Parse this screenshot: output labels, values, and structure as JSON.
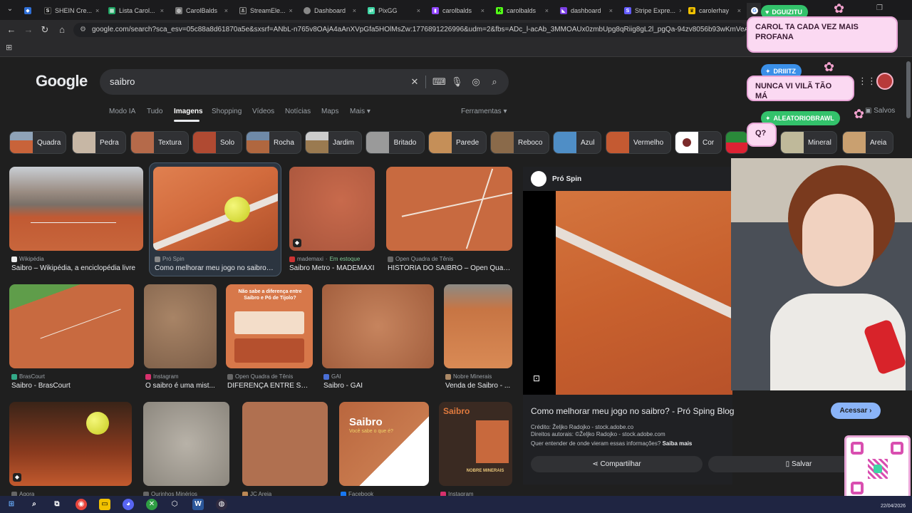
{
  "browser": {
    "tabs": [
      {
        "label": "",
        "icon": "diamond-icon",
        "color": "#2f6fd6"
      },
      {
        "label": "SHEIN Cre...",
        "icon": "shein-icon",
        "color": "#111111"
      },
      {
        "label": "Lista Carol...",
        "icon": "sheets-icon",
        "color": "#1ea362"
      },
      {
        "label": "CarolBalds",
        "icon": "globe-icon",
        "color": "#777777"
      },
      {
        "label": "StreamEle...",
        "icon": "streamelements-icon",
        "color": "#222222"
      },
      {
        "label": "Dashboard",
        "icon": "globe-icon",
        "color": "#888888"
      },
      {
        "label": "PixGG",
        "icon": "pixgg-icon",
        "color": "#3fd6a5"
      },
      {
        "label": "carolbalds",
        "icon": "twitch-icon",
        "color": "#9146ff"
      },
      {
        "label": "carolbalds",
        "icon": "kick-icon",
        "color": "#53fc18"
      },
      {
        "label": "dashboard",
        "icon": "dashboard-icon",
        "color": "#7b3fe4"
      },
      {
        "label": "Stripe Expre...",
        "icon": "stripe-icon",
        "color": "#635bff"
      },
      {
        "label": "carolerhay",
        "icon": "crown-icon",
        "color": "#f2c200"
      },
      {
        "label": "",
        "icon": "google-icon",
        "color": "#ffffff"
      }
    ],
    "url": "google.com/search?sca_esv=05c88a8d61870a5e&sxsrf=ANbL-n765v8OAjA4aAnXVpGfa5HOlMsZw:1776891226996&udm=2&fbs=ADc_l-acAb_3MMOAUx0zmbUpg8qRiig8gL2l_pgQa-94zv8056b93wKmVeAAORa3GINFZT6T67F"
  },
  "google": {
    "logo": "Google",
    "query": "saibro",
    "nav_tabs": [
      "Modo IA",
      "Tudo",
      "Imagens",
      "Shopping",
      "Vídeos",
      "Notícias",
      "Maps",
      "Mais"
    ],
    "active_tab": "Imagens",
    "tools": "Ferramentas",
    "saved": "Salvos",
    "chips": [
      "Quadra",
      "Pedra",
      "Textura",
      "Solo",
      "Rocha",
      "Jardim",
      "Britado",
      "Parede",
      "Reboco",
      "Azul",
      "Vermelho",
      "Cor",
      "",
      "Mineral",
      "Areia"
    ],
    "results": [
      {
        "source": "Wikipédia",
        "title": "Saibro – Wikipédia, a enciclopédia livre",
        "stock": ""
      },
      {
        "source": "Pró Spin",
        "title": "Como melhorar meu jogo no saibro? ...",
        "stock": ""
      },
      {
        "source": "mademaxi",
        "title": "Saibro Metro - MADEMAXI",
        "stock": "Em estoque"
      },
      {
        "source": "Open Quadra de Tênis",
        "title": "HISTÓRIA DO SAIBRO – Open Quad...",
        "stock": ""
      },
      {
        "source": "BrasCourt",
        "title": "Saibro - BrasCourt",
        "stock": ""
      },
      {
        "source": "Instagram",
        "title": "O saibro é uma mist...",
        "stock": ""
      },
      {
        "source": "Open Quadra de Tênis",
        "title": "DIFERENÇA ENTRE SAI...",
        "stock": ""
      },
      {
        "source": "GAI",
        "title": "Saibro - GAI",
        "stock": ""
      },
      {
        "source": "Nobre Minerais",
        "title": "Venda de Saibro - ...",
        "stock": ""
      },
      {
        "source": "Agora",
        "title": "",
        "stock": ""
      },
      {
        "source": "Ourinhos Minérios",
        "title": "",
        "stock": ""
      },
      {
        "source": "JC Areia",
        "title": "",
        "stock": ""
      },
      {
        "source": "Facebook",
        "title": "",
        "stock": ""
      },
      {
        "source": "Instagram",
        "title": "",
        "stock": ""
      }
    ],
    "infographic_text": "Não sabe a diferença entre Saibro e Pó de Tijolo?",
    "card_saibro_1": "Saibro",
    "card_saibro_1_sub": "Você sabe o que é?",
    "card_saibro_2": "Saibro",
    "card_saibro_2_brand": "NOBRE MINERAIS"
  },
  "preview": {
    "source": "Pró Spin",
    "title": "Como melhorar meu jogo no saibro? - Pró Sping Blog",
    "visit": "Acessar",
    "credit": "Crédito: Željko Radojko - stock.adobe.co",
    "copyright": "Direitos autorais: ©Željko Radojko - stock.adobe.com",
    "license_q": "Quer entender de onde vieram essas informações?",
    "license_link": "Saiba mais",
    "share": "Compartilhar",
    "save": "Salvar"
  },
  "chat": [
    {
      "user": "DGUIZITU",
      "message": "CAROL TA CADA VEZ MAIS PROFANA",
      "color": "#33c26b"
    },
    {
      "user": "DRIIITZ",
      "message": "NUNCA VI VILÃ TÃO MÁ",
      "color": "#3a8fe8"
    },
    {
      "user": "ALEATORIOBRAWL",
      "message": "Q?",
      "color": "#33c26b"
    }
  ],
  "taskbar": {
    "date": "22/04/2026"
  }
}
